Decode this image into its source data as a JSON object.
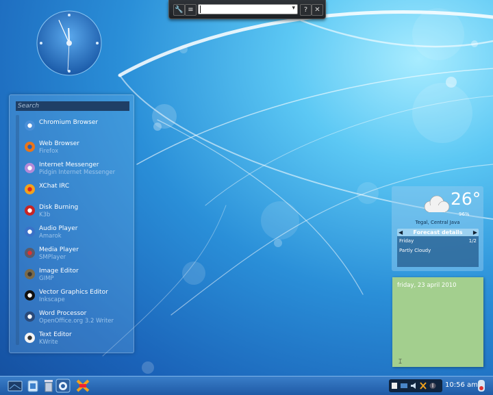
{
  "krunner": {
    "help_label": "?",
    "close_label": "✕",
    "settings_label": "≡"
  },
  "launcher": {
    "search_placeholder": "Search",
    "apps": [
      {
        "name": "Chromium Browser",
        "sub": "",
        "icon": "chromium-icon"
      },
      {
        "name": "Web Browser",
        "sub": "Firefox",
        "icon": "firefox-icon"
      },
      {
        "name": "Internet Messenger",
        "sub": "Pidgin Internet Messenger",
        "icon": "pidgin-icon"
      },
      {
        "name": "XChat IRC",
        "sub": "",
        "icon": "xchat-icon"
      },
      {
        "name": "Disk Burning",
        "sub": "K3b",
        "icon": "k3b-icon"
      },
      {
        "name": "Audio Player",
        "sub": "Amarok",
        "icon": "amarok-icon"
      },
      {
        "name": "Media Player",
        "sub": "SMPlayer",
        "icon": "smplayer-icon"
      },
      {
        "name": "Image Editor",
        "sub": "GIMP",
        "icon": "gimp-icon"
      },
      {
        "name": "Vector Graphics Editor",
        "sub": "Inkscape",
        "icon": "inkscape-icon"
      },
      {
        "name": "Word Processor",
        "sub": "OpenOffice.org 3.2 Writer",
        "icon": "writer-icon"
      },
      {
        "name": "Text Editor",
        "sub": "KWrite",
        "icon": "kwrite-icon"
      }
    ]
  },
  "weather": {
    "temperature": "26°",
    "humidity": "96%",
    "location": "Tegal, Central Java",
    "forecast_title": "Forecast details",
    "day": "Friday",
    "page": "1/2",
    "condition": "Partly Cloudy"
  },
  "note": {
    "text": "friday, 23 april 2010"
  },
  "clock": {
    "hour": 11,
    "minute": 56
  },
  "taskbar": {
    "time": "10:56 am"
  },
  "colors": {
    "accent": "#2a8fd8",
    "note": "#a3cf8e",
    "panel": "#1e5aa6"
  }
}
